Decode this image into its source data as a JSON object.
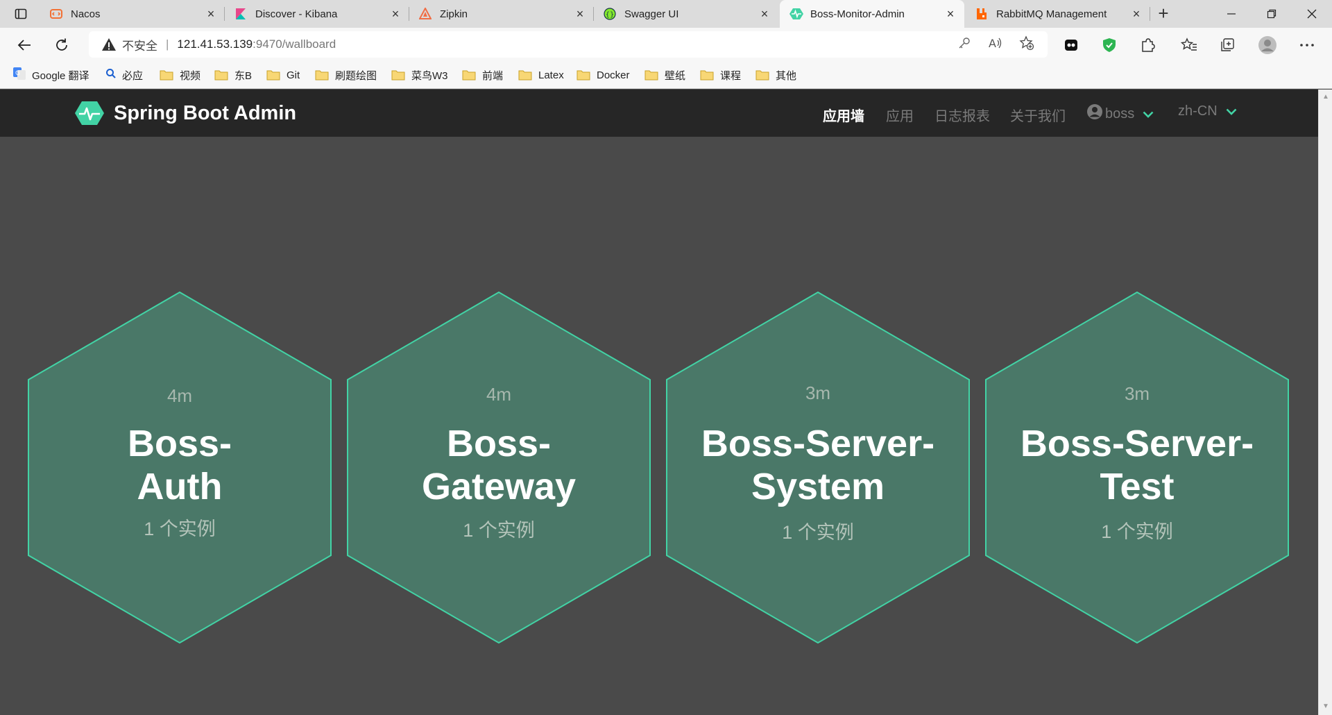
{
  "browser": {
    "tabs": [
      {
        "title": "Nacos",
        "favicon": "nacos-icon",
        "color": "#f27135"
      },
      {
        "title": "Discover - Kibana",
        "favicon": "kibana-icon",
        "color": "#e8478b"
      },
      {
        "title": "Zipkin",
        "favicon": "zipkin-icon",
        "color": "#f06d45"
      },
      {
        "title": "Swagger UI",
        "favicon": "swagger-icon",
        "color": "#85ea2d"
      },
      {
        "title": "Boss-Monitor-Admin",
        "favicon": "pulse-icon",
        "color": "#42d3a5",
        "active": true
      },
      {
        "title": "RabbitMQ Management",
        "favicon": "rabbitmq-icon",
        "color": "#ff6600"
      }
    ],
    "address": {
      "insecure_label": "不安全",
      "url_host": "121.41.53.139",
      "url_rest": ":9470/wallboard"
    },
    "bookmarks": [
      "Google 翻译",
      "必应",
      "视频",
      "东B",
      "Git",
      "刷题绘图",
      "菜鸟W3",
      "前端",
      "Latex",
      "Docker",
      "壁纸",
      "课程",
      "其他"
    ]
  },
  "app": {
    "brand": "Spring Boot Admin",
    "accent_color": "#42d3a5",
    "nav": {
      "wallboard": "应用墙",
      "applications": "应用",
      "journal": "日志报表",
      "about": "关于我们",
      "user": "boss",
      "language": "zh-CN"
    },
    "applications": [
      {
        "uptime": "4m",
        "name_line1": "Boss-",
        "name_line2": "Auth",
        "instances": "1 个实例"
      },
      {
        "uptime": "4m",
        "name_line1": "Boss-",
        "name_line2": "Gateway",
        "instances": "1 个实例"
      },
      {
        "uptime": "3m",
        "name_line1": "Boss-Server-",
        "name_line2": "System",
        "instances": "1 个实例"
      },
      {
        "uptime": "3m",
        "name_line1": "Boss-Server-",
        "name_line2": "Test",
        "instances": "1 个实例"
      }
    ]
  }
}
